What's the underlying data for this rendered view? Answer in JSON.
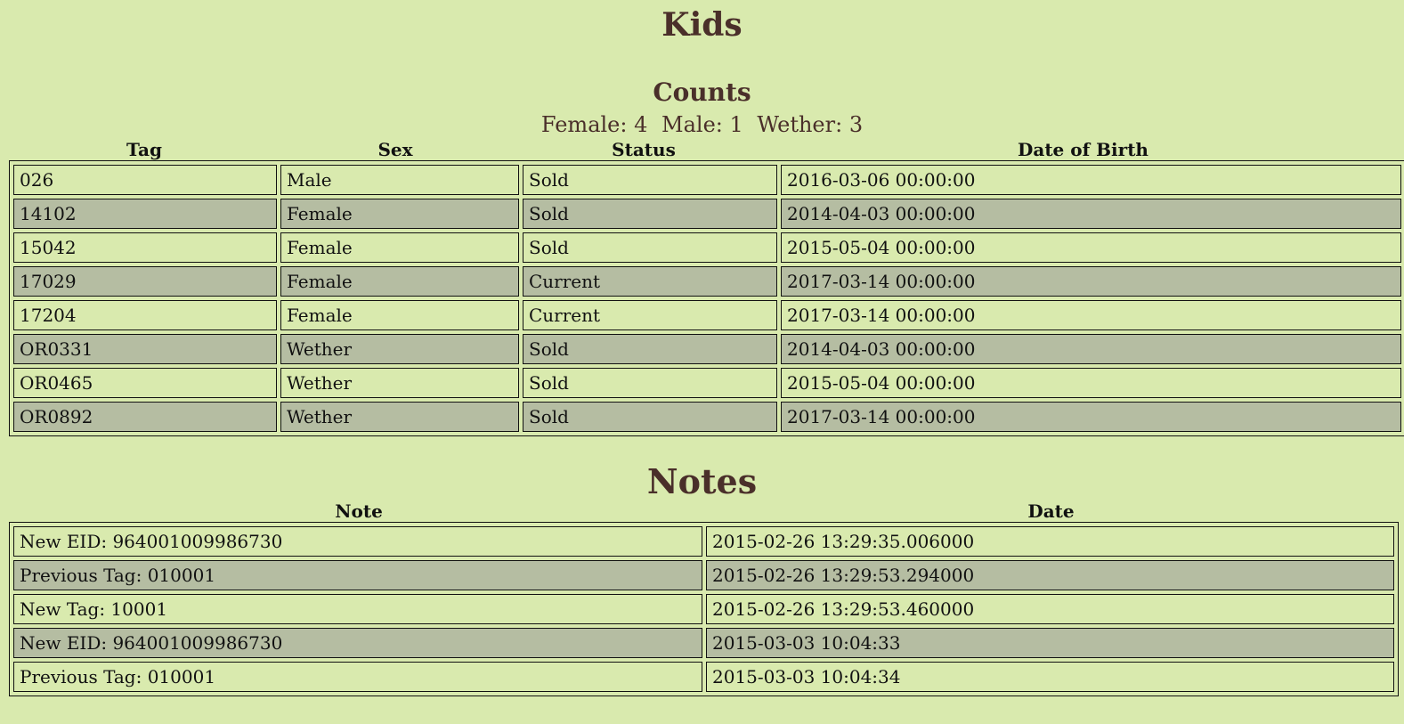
{
  "kids": {
    "title": "Kids",
    "counts_title": "Counts",
    "counts": [
      {
        "label": "Female: 4"
      },
      {
        "label": "Male: 1"
      },
      {
        "label": "Wether: 3"
      }
    ],
    "headers": [
      "Tag",
      "Sex",
      "Status",
      "Date of Birth"
    ],
    "rows": [
      {
        "tag": "026",
        "sex": "Male",
        "status": "Sold",
        "dob": "2016-03-06 00:00:00"
      },
      {
        "tag": "14102",
        "sex": "Female",
        "status": "Sold",
        "dob": "2014-04-03 00:00:00"
      },
      {
        "tag": "15042",
        "sex": "Female",
        "status": "Sold",
        "dob": "2015-05-04 00:00:00"
      },
      {
        "tag": "17029",
        "sex": "Female",
        "status": "Current",
        "dob": "2017-03-14 00:00:00"
      },
      {
        "tag": "17204",
        "sex": "Female",
        "status": "Current",
        "dob": "2017-03-14 00:00:00"
      },
      {
        "tag": "OR0331",
        "sex": "Wether",
        "status": "Sold",
        "dob": "2014-04-03 00:00:00"
      },
      {
        "tag": "OR0465",
        "sex": "Wether",
        "status": "Sold",
        "dob": "2015-05-04 00:00:00"
      },
      {
        "tag": "OR0892",
        "sex": "Wether",
        "status": "Sold",
        "dob": "2017-03-14 00:00:00"
      }
    ]
  },
  "notes": {
    "title": "Notes",
    "headers": [
      "Note",
      "Date"
    ],
    "rows": [
      {
        "note": "New EID: 964001009986730",
        "date": "2015-02-26 13:29:35.006000"
      },
      {
        "note": "Previous Tag: 010001",
        "date": "2015-02-26 13:29:53.294000"
      },
      {
        "note": "New Tag: 10001",
        "date": "2015-02-26 13:29:53.460000"
      },
      {
        "note": "New EID: 964001009986730",
        "date": "2015-03-03 10:04:33"
      },
      {
        "note": "Previous Tag: 010001",
        "date": "2015-03-03 10:04:34"
      }
    ]
  },
  "colors": {
    "background": "#d9eaae",
    "alt_row": "#b5bda2",
    "heading": "#4a2f2a"
  }
}
